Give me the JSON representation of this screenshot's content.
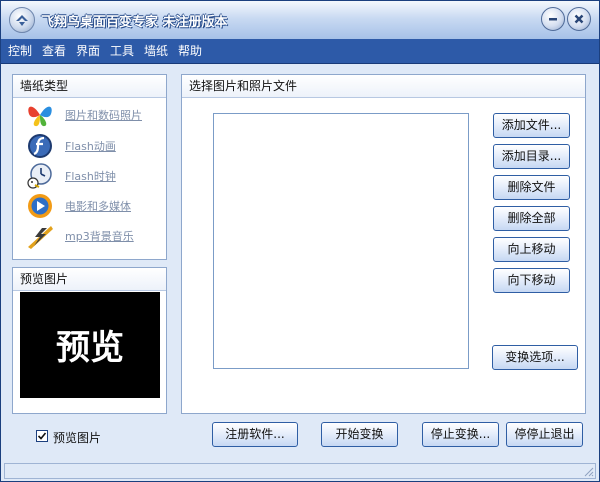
{
  "window": {
    "title": "飞翔鸟桌面百变专家   未注册版本"
  },
  "menu": [
    "控制",
    "查看",
    "界面",
    "工具",
    "墙纸",
    "帮助"
  ],
  "wallpaper_types": {
    "title": "墙纸类型",
    "items": [
      {
        "label": "图片和数码照片",
        "icon": "butterfly-icon"
      },
      {
        "label": "Flash动画",
        "icon": "flash-icon"
      },
      {
        "label": "Flash时钟",
        "icon": "clock-icon"
      },
      {
        "label": "电影和多媒体",
        "icon": "media-player-icon"
      },
      {
        "label": "mp3背景音乐",
        "icon": "music-icon"
      }
    ]
  },
  "preview": {
    "title": "预览图片",
    "image_text": "预览",
    "checkbox_label": "预览图片",
    "checked": true
  },
  "files": {
    "title": "选择图片和照片文件"
  },
  "side_buttons": [
    "添加文件...",
    "添加目录...",
    "删除文件",
    "删除全部",
    "向上移动",
    "向下移动"
  ],
  "options_button": "变换选项...",
  "bottom_buttons": [
    "注册软件...",
    "开始变换",
    "停止变换...",
    "停停止退出"
  ],
  "colors": {
    "menubar": "#2d5aa8",
    "background": "#dfe9f7",
    "border": "#8ea7cc"
  }
}
